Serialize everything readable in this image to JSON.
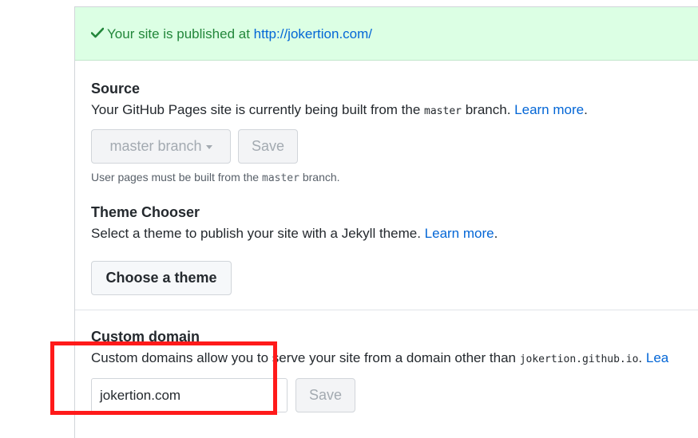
{
  "flash": {
    "check_icon": "check-icon",
    "text": "Your site is published at ",
    "url": "http://jokertion.com/"
  },
  "source": {
    "title": "Source",
    "desc_prefix": "Your GitHub Pages site is currently being built from the ",
    "branch_code": "master",
    "desc_suffix": " branch. ",
    "learn_more": "Learn more",
    "period": ".",
    "branch_button": "master branch",
    "save_button": "Save",
    "note_prefix": "User pages must be built from the ",
    "note_code": "master",
    "note_suffix": " branch."
  },
  "theme": {
    "title": "Theme Chooser",
    "desc": "Select a theme to publish your site with a Jekyll theme. ",
    "learn_more": "Learn more",
    "period": ".",
    "button": "Choose a theme"
  },
  "custom_domain": {
    "title": "Custom domain",
    "desc_prefix": "Custom domains allow you to serve your site from a domain other than ",
    "domain_code": "jokertion.github.io",
    "desc_suffix": ". ",
    "learn_more": "Lea",
    "input_value": "jokertion.com",
    "save_button": "Save"
  },
  "colors": {
    "flash_bg": "#dcffe4",
    "flash_text": "#22863a",
    "link": "#0366d6",
    "highlight_box": "#ff1a1a"
  }
}
